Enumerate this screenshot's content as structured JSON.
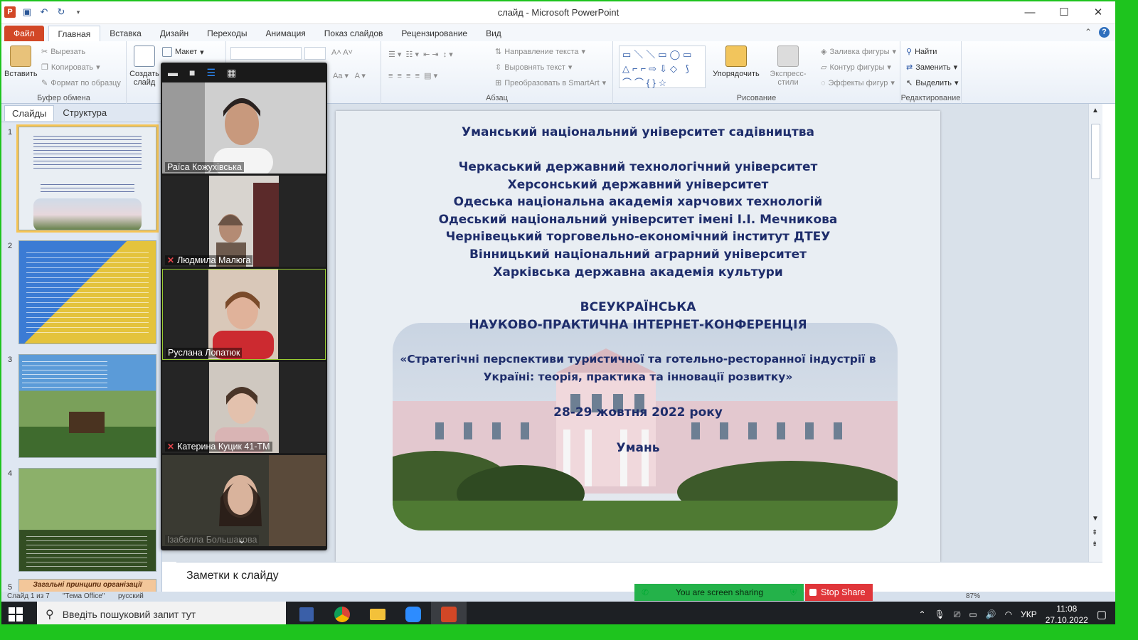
{
  "window": {
    "title": "слайд  -  Microsoft PowerPoint",
    "controls": [
      "—",
      "☐",
      "✕"
    ]
  },
  "ribbon": {
    "tabs": [
      "Файл",
      "Главная",
      "Вставка",
      "Дизайн",
      "Переходы",
      "Анимация",
      "Показ слайдов",
      "Рецензирование",
      "Вид"
    ],
    "active_tab": "Главная",
    "clipboard": {
      "paste": "Вставить",
      "cut": "Вырезать",
      "copy": "Копировать",
      "format": "Формат по образцу",
      "label": "Буфер обмена"
    },
    "slides": {
      "new_slide": "Создать слайд",
      "layout": "Макет"
    },
    "paragraph": {
      "text_direction": "Направление текста",
      "align_text": "Выровнять текст",
      "smartart": "Преобразовать в SmartArt",
      "label": "Абзац"
    },
    "drawing": {
      "arrange": "Упорядочить",
      "quick_styles": "Экспресс-стили",
      "fill": "Заливка фигуры",
      "outline": "Контур фигуры",
      "effects": "Эффекты фигур",
      "label": "Рисование"
    },
    "editing": {
      "find": "Найти",
      "replace": "Заменить",
      "select": "Выделить",
      "label": "Редактирование"
    }
  },
  "left_pane": {
    "tabs": [
      "Слайды",
      "Структура"
    ],
    "slide_numbers": [
      "1",
      "2",
      "3",
      "4",
      "5"
    ],
    "slide5_title": "Загальні принципи організації"
  },
  "slide": {
    "lines": [
      "Уманський національний університет садівництва",
      "Черкаський державний технологічний університет",
      "Херсонський державний університет",
      "Одеська національна академія харчових технологій",
      "Одеський національний університет імені І.І. Мечникова",
      "Чернівецький торговельно-економічний інститут ДТЕУ",
      "Вінницький національний аграрний університет",
      "Харківська державна академія культури",
      "ВСЕУКРАЇНСЬКА",
      "НАУКОВО-ПРАКТИЧНА ІНТЕРНЕТ-КОНФЕРЕНЦІЯ",
      "«Стратегічні перспективи туристичної та готельно-ресторанної індустрії в",
      "Україні: теорія, практика та інновації розвитку»",
      "28-29 жовтня 2022 року",
      "Умань"
    ]
  },
  "notes": {
    "placeholder": "Заметки к слайду"
  },
  "statusbar": {
    "slide_info": "Слайд 1 из 7",
    "theme": "\"Тема Office\"",
    "language": "русский",
    "zoom": "87%"
  },
  "zoom": {
    "participants": [
      {
        "name": "Раїса Кожухівська",
        "muted": false
      },
      {
        "name": "Людмила Малюга",
        "muted": true
      },
      {
        "name": "Руслана Лопатюк",
        "muted": false
      },
      {
        "name": "Катерина Куцик 41-ТМ",
        "muted": true
      },
      {
        "name": "Ізабелла Большакова",
        "muted": false
      }
    ],
    "sharing_text": "You are screen sharing",
    "stop_share": "Stop Share"
  },
  "taskbar": {
    "search_placeholder": "Введіть пошуковий запит тут",
    "lang": "УКР",
    "time": "11:08",
    "date": "27.10.2022"
  },
  "colors": {
    "ppt_accent": "#d24726",
    "slide_text": "#1e2d6b",
    "share_green": "#24b24a",
    "stop_red": "#e0363a",
    "chrome_border": "#1ec41e"
  }
}
